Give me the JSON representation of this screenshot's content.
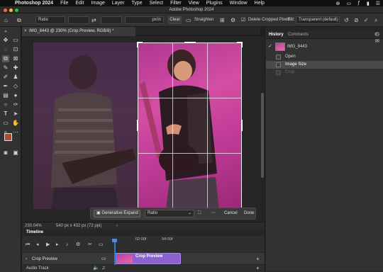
{
  "menubar": {
    "app_name": "Photoshop 2024",
    "items": [
      "File",
      "Edit",
      "Image",
      "Layer",
      "Type",
      "Select",
      "Filter",
      "View",
      "Plugins",
      "Window",
      "Help"
    ]
  },
  "window": {
    "title": "Adobe Photoshop 2024"
  },
  "options": {
    "ratio_label": "Ratio",
    "unit_label": "px/in",
    "clear_label": "Clear",
    "straighten_label": "Straighten",
    "delete_cropped_label": "Delete Cropped Pixels",
    "fill_label": "Fill:",
    "fill_value": "Transparent (default)"
  },
  "document": {
    "tab_title": "IMG_8443 @ 230% (Crop Preview, RGB/8) *",
    "zoom": "230.04%",
    "dimensions": "540 px x 432 px (72 ppi)"
  },
  "context_bar": {
    "generative_expand_label": "Generative Expand",
    "ratio_value": "Ratio",
    "cancel_label": "Cancel",
    "done_label": "Done"
  },
  "panels": {
    "tabs": [
      "History",
      "Comments"
    ],
    "snapshot_name": "IMG_8443",
    "history_items": [
      {
        "label": "Open",
        "state": "normal"
      },
      {
        "label": "Image Size",
        "state": "selected"
      },
      {
        "label": "Crop",
        "state": "dimmed"
      }
    ]
  },
  "timeline": {
    "panel_title": "Timeline",
    "ruler": [
      "02:00f",
      "04:00f"
    ],
    "track_name": "Crop Preview",
    "clip_label": "Crop Preview",
    "audio_track_label": "Audio Track"
  },
  "colors": {
    "accent": "#2e79d6",
    "clip": "#8a63d1",
    "foreground": "#b5482f",
    "background": "#ffffff"
  }
}
